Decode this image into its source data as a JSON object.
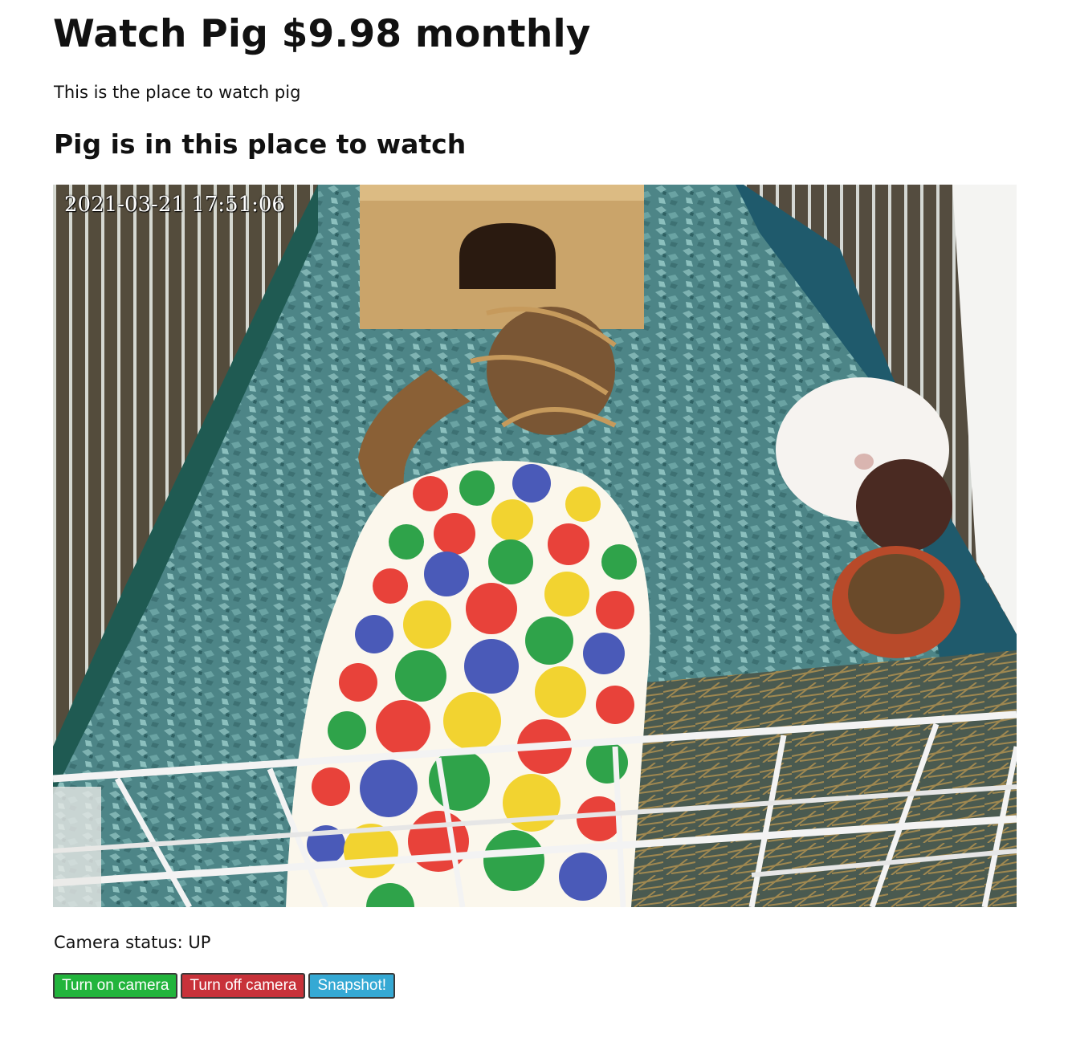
{
  "header": {
    "title": "Watch Pig $9.98 monthly",
    "tagline": "This is the place to watch pig",
    "subtitle": "Pig is in this place to watch"
  },
  "camera": {
    "timestamp": "2021-03-21 17:51:06",
    "status_label": "Camera status:",
    "status_value": "UP"
  },
  "controls": {
    "turn_on_label": "Turn on camera",
    "turn_off_label": "Turn off camera",
    "snapshot_label": "Snapshot!"
  },
  "colors": {
    "turn_on": "#22b43c",
    "turn_off": "#c8323a",
    "snapshot": "#35a9d4"
  }
}
